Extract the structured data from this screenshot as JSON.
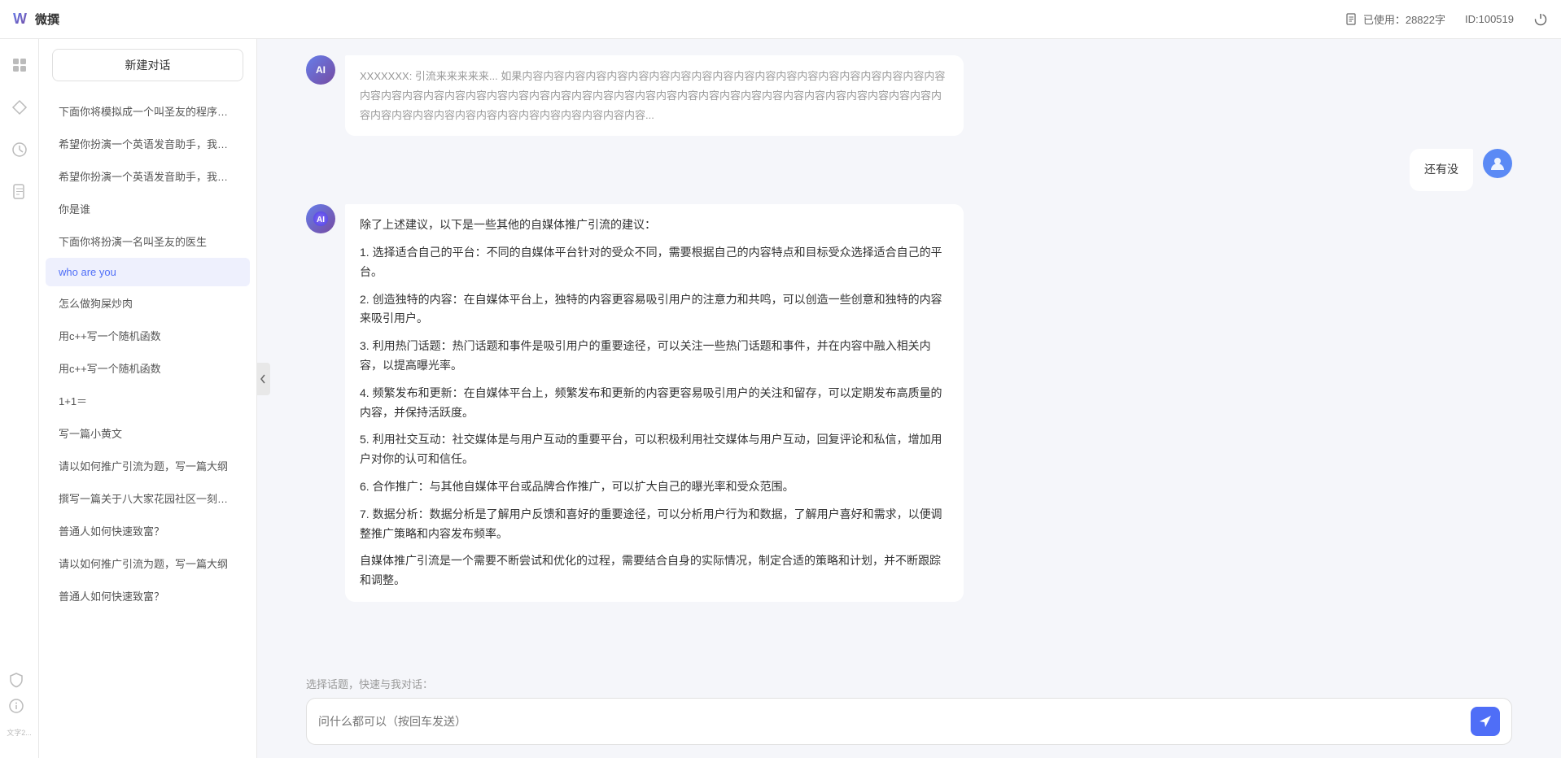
{
  "topbar": {
    "title": "微撰",
    "usage_label": "已使用：28822字",
    "usage_icon": "document-icon",
    "id_label": "ID:100519",
    "power_icon": "power-icon"
  },
  "icon_sidebar": {
    "items": [
      {
        "name": "home-icon",
        "icon": "⊞",
        "active": false
      },
      {
        "name": "diamond-icon",
        "icon": "◇",
        "active": false
      },
      {
        "name": "clock-icon",
        "icon": "◷",
        "active": false
      },
      {
        "name": "document-icon",
        "icon": "☰",
        "active": false
      }
    ],
    "bottom_items": [
      {
        "name": "shield-icon",
        "icon": "⊕"
      },
      {
        "name": "info-icon",
        "icon": "ℹ"
      },
      {
        "name": "bottom-text",
        "icon": "文字2..."
      }
    ]
  },
  "chat_sidebar": {
    "new_chat_label": "新建对话",
    "chat_items": [
      {
        "text": "下面你将模拟成一个叫圣友的程序员，我说...",
        "active": false
      },
      {
        "text": "希望你扮演一个英语发音助手，我提供给你...",
        "active": false
      },
      {
        "text": "希望你扮演一个英语发音助手，我提供给你...",
        "active": false
      },
      {
        "text": "你是谁",
        "active": false
      },
      {
        "text": "下面你将扮演一名叫圣友的医生",
        "active": false
      },
      {
        "text": "who are you",
        "active": true
      },
      {
        "text": "怎么做狗屎炒肉",
        "active": false
      },
      {
        "text": "用c++写一个随机函数",
        "active": false
      },
      {
        "text": "用c++写一个随机函数",
        "active": false
      },
      {
        "text": "1+1＝",
        "active": false
      },
      {
        "text": "写一篇小黄文",
        "active": false
      },
      {
        "text": "请以如何推广引流为题，写一篇大纲",
        "active": false
      },
      {
        "text": "撰写一篇关于八大家花园社区一刻钟便民生...",
        "active": false
      },
      {
        "text": "普通人如何快速致富？",
        "active": false
      },
      {
        "text": "请以如何推广引流为题，写一篇大纲",
        "active": false
      },
      {
        "text": "普通人如何快速致富？",
        "active": false
      }
    ]
  },
  "chat_messages": {
    "top_truncated_text": "XXXXXXX: 引流来来来来来... 如果内容内容内容内容内容内容内容内容内容内容内容内容内容内容内容内容内容内容内容内容内容内容内容内容内容内容内容内容内容内容内容内容内容内容内容内容内容内容内容内容内容内容内容内容内容内容内容内容内容内容内容内容内容内容内容内容内容内容内容内容内容...",
    "user_message_1": "还有没",
    "ai_response_1": {
      "intro": "除了上述建议，以下是一些其他的自媒体推广引流的建议：",
      "points": [
        "1. 选择适合自己的平台：不同的自媒体平台针对的受众不同，需要根据自己的内容特点和目标受众选择适合自己的平台。",
        "2. 创造独特的内容：在自媒体平台上，独特的内容更容易吸引用户的注意力和共鸣，可以创造一些创意和独特的内容来吸引用户。",
        "3. 利用热门话题：热门话题和事件是吸引用户的重要途径，可以关注一些热门话题和事件，并在内容中融入相关内容，以提高曝光率。",
        "4. 频繁发布和更新：在自媒体平台上，频繁发布和更新的内容更容易吸引用户的关注和留存，可以定期发布高质量的内容，并保持活跃度。",
        "5. 利用社交互动：社交媒体是与用户互动的重要平台，可以积极利用社交媒体与用户互动，回复评论和私信，增加用户对你的认可和信任。",
        "6. 合作推广：与其他自媒体平台或品牌合作推广，可以扩大自己的曝光率和受众范围。",
        "7. 数据分析：数据分析是了解用户反馈和喜好的重要途径，可以分析用户行为和数据，了解用户喜好和需求，以便调整推广策略和内容发布频率。"
      ],
      "conclusion": "自媒体推广引流是一个需要不断尝试和优化的过程，需要结合自身的实际情况，制定合适的策略和计划，并不断跟踪和调整。"
    }
  },
  "input_area": {
    "quick_topics_label": "选择话题，快速与我对话：",
    "input_placeholder": "问什么都可以（按回车发送）",
    "send_icon": "send-icon"
  }
}
